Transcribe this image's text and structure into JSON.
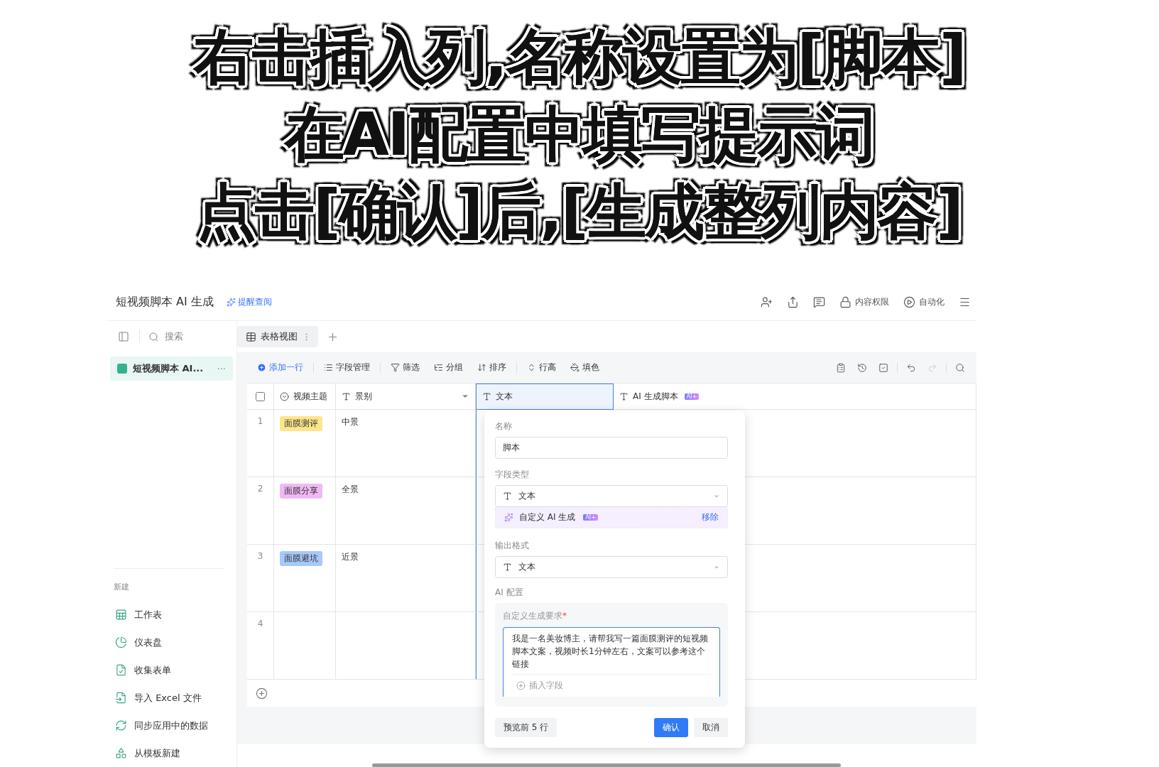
{
  "caption": {
    "lines": [
      "右击插入列,名称设置为[脚本]",
      "在AI配置中填写提示词",
      "点击[确认]后,[生成整列内容]"
    ]
  },
  "header": {
    "title": "短视频脚本 AI 生成",
    "remind_link": "提醒查阅",
    "actions": [
      {
        "kind": "invite"
      },
      {
        "kind": "share"
      },
      {
        "kind": "comment"
      },
      {
        "kind": "permission",
        "label": "内容权限"
      },
      {
        "kind": "automation",
        "label": "自动化"
      },
      {
        "kind": "menu"
      }
    ]
  },
  "sidebar": {
    "search_placeholder": "搜索",
    "tables": [
      {
        "label": "短视频脚本 AI...",
        "more": "···",
        "selected": true
      }
    ],
    "new_title": "新建",
    "new_items": [
      {
        "kind": "sheet",
        "label": "工作表"
      },
      {
        "kind": "dashboard",
        "label": "仪表盘"
      },
      {
        "kind": "form",
        "label": "收集表单"
      },
      {
        "kind": "import",
        "label": "导入 Excel 文件"
      },
      {
        "kind": "sync",
        "label": "同步应用中的数据"
      },
      {
        "kind": "template",
        "label": "从模板新建"
      }
    ]
  },
  "view_tabs": [
    {
      "label": "表格视图",
      "selected": true
    }
  ],
  "toolbar": {
    "items": [
      {
        "kind": "add",
        "label": "添加一行"
      },
      {
        "kind": "fields",
        "label": "字段管理"
      },
      {
        "kind": "filter",
        "label": "筛选"
      },
      {
        "kind": "group",
        "label": "分组"
      },
      {
        "kind": "sort",
        "label": "排序"
      },
      {
        "kind": "height",
        "label": "行高"
      },
      {
        "kind": "fill",
        "label": "填色"
      }
    ],
    "tools": [
      {
        "kind": "clipboard"
      },
      {
        "kind": "history"
      },
      {
        "kind": "check"
      },
      {
        "kind": "undo"
      },
      {
        "kind": "redo"
      },
      {
        "kind": "search"
      }
    ]
  },
  "table": {
    "select_all": {
      "checked": false
    },
    "columns": [
      {
        "kind": "option",
        "label": "视频主题",
        "selected": false
      },
      {
        "kind": "text",
        "label": "景别",
        "selected": false
      },
      {
        "kind": "text",
        "label": "文本",
        "selected": true
      },
      {
        "kind": "ai",
        "label": "AI 生成脚本",
        "badge": "AI+",
        "selected": false
      }
    ],
    "rows": [
      {
        "number": "1",
        "topic": "面膜测评",
        "color": "#fde68a",
        "shot": "中景"
      },
      {
        "number": "2",
        "topic": "面膜分享",
        "color": "#f0b8f5",
        "shot": "全景"
      },
      {
        "number": "3",
        "topic": "面膜避坑",
        "color": "#a7c8fb",
        "shot": "近景"
      },
      {
        "number": "4"
      }
    ]
  },
  "field_popup": {
    "name_label": "名称",
    "name_value": "脚本",
    "type_label": "字段类型",
    "type_value": "文本",
    "ai_option": "自定义 AI 生成",
    "ai_badge": "AI+",
    "remove": "移除",
    "output_label": "输出格式",
    "output_value": "文本",
    "ai_config_label": "AI 配置",
    "prompt_label": "自定义生成要求",
    "prompt_required": "*",
    "prompt_text": "我是一名美妆博主，请帮我写一篇面膜测评的短视频脚本文案，视频时长1分钟左右，文案可以参考这个链接",
    "insert_field": "插入字段",
    "preview_button": "预览前 5 行",
    "confirm_button": "确认",
    "cancel_button": "取消"
  }
}
